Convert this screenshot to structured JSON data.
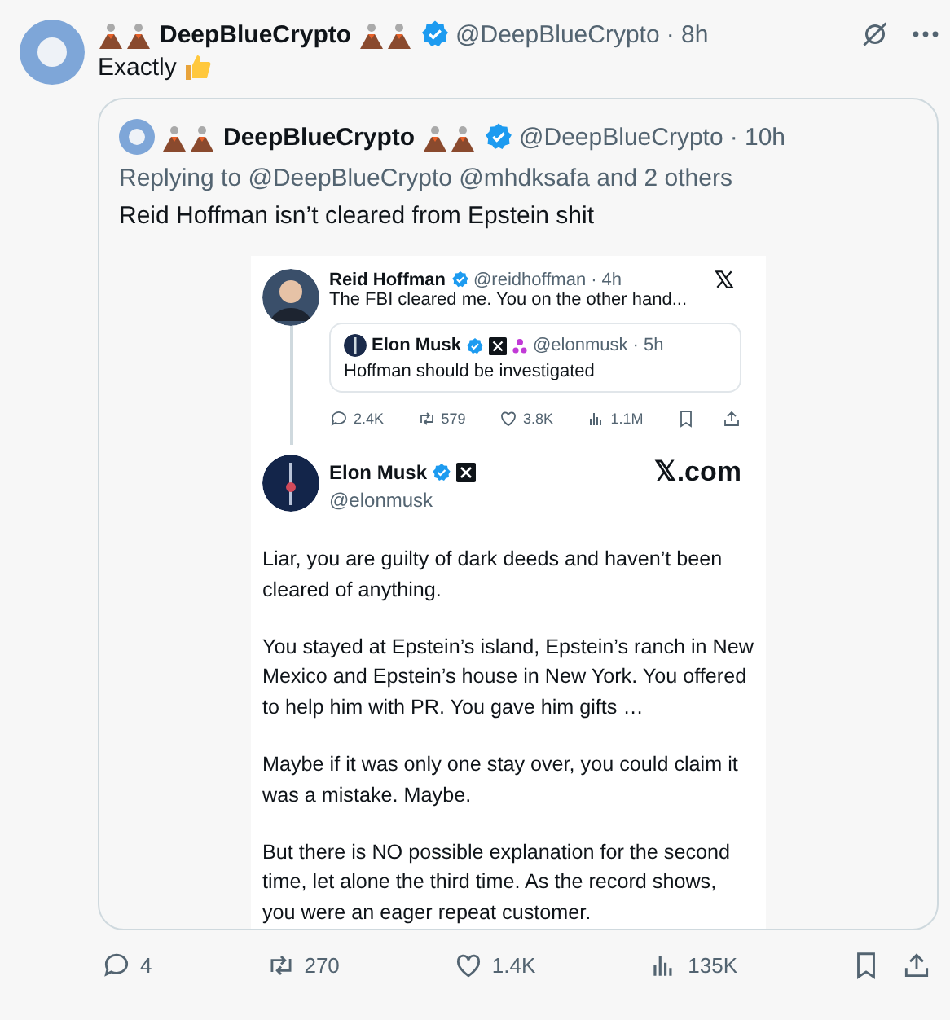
{
  "post": {
    "display_name": "DeepBlueCrypto",
    "verified": true,
    "handle": "@DeepBlueCrypto",
    "time": "· 8h",
    "text": "Exactly",
    "quote": {
      "display_name": "DeepBlueCrypto",
      "verified": true,
      "handle": "@DeepBlueCrypto",
      "time": "· 10h",
      "replying_to": "Replying to @DeepBlueCrypto @mhdksafa and 2 others",
      "text": "Reid Hoffman isn’t cleared from Epstein shit",
      "screenshot": {
        "tweet": {
          "display_name": "Reid Hoffman",
          "verified": true,
          "handle": "@reidhoffman",
          "time": "· 4h",
          "text": "The FBI cleared me. You on the other hand...",
          "quoted": {
            "display_name": "Elon Musk",
            "verified": true,
            "handle": "@elonmusk",
            "time": "· 5h",
            "text": "Hoffman should be investigated"
          },
          "stats": [
            {
              "kind": "reply",
              "count": "2.4K"
            },
            {
              "kind": "repost",
              "count": "579"
            },
            {
              "kind": "like",
              "count": "3.8K"
            },
            {
              "kind": "views",
              "count": "1.1M"
            },
            {
              "kind": "bookmark"
            },
            {
              "kind": "share"
            }
          ]
        },
        "reply": {
          "display_name": "Elon Musk",
          "verified": true,
          "handle": "@elonmusk",
          "brand": "𝕏.com",
          "paragraphs": [
            "Liar, you are guilty of dark deeds and haven’t been cleared of anything.",
            "You stayed at Epstein’s island, Epstein’s ranch in New Mexico and Epstein’s house in New York. You offered to help him with PR. You gave him gifts …",
            "Maybe if it was only one stay over, you could claim it was a mistake. Maybe.",
            "But there is NO possible explanation for the second time, let alone the third time. As the record shows, you were an eager repeat customer."
          ]
        }
      }
    },
    "actions": [
      {
        "kind": "reply",
        "count": "4"
      },
      {
        "kind": "repost",
        "count": "270"
      },
      {
        "kind": "like",
        "count": "1.4K"
      },
      {
        "kind": "views",
        "count": "135K"
      },
      {
        "kind": "bookmark"
      },
      {
        "kind": "share"
      }
    ]
  }
}
